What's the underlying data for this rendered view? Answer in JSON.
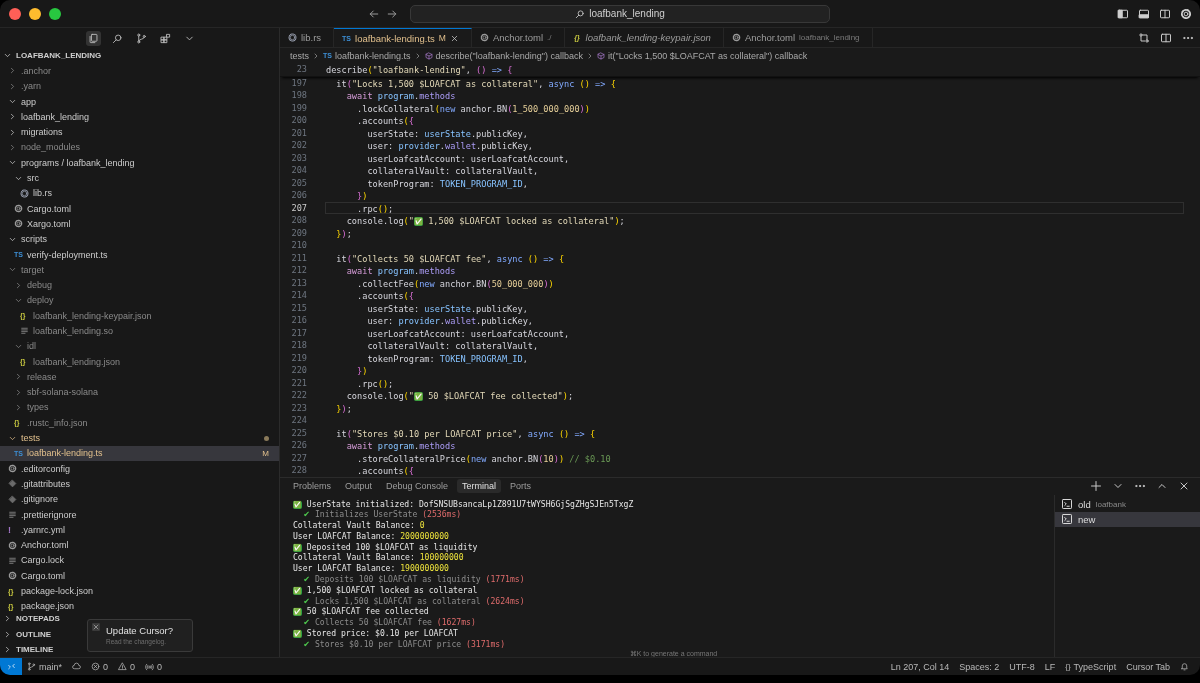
{
  "title_bar": {
    "search": "loafbank_lending"
  },
  "explorer": {
    "title": "LOAFBANK_LENDING",
    "expanded": true,
    "items": [
      {
        "name": ".anchor",
        "kind": "folder",
        "expanded": false,
        "dimmed": true,
        "modified": false,
        "selected": false
      },
      {
        "name": ".yarn",
        "kind": "folder",
        "expanded": false,
        "dimmed": true,
        "modified": false,
        "selected": false
      },
      {
        "name": "app",
        "kind": "folder",
        "expanded": true,
        "dimmed": false,
        "modified": false,
        "selected": false
      },
      {
        "name": "loafbank_lending",
        "kind": "folder",
        "expanded": false,
        "dimmed": false,
        "modified": false,
        "selected": false
      },
      {
        "name": "migrations",
        "kind": "folder",
        "expanded": false,
        "dimmed": false,
        "modified": false,
        "selected": false
      },
      {
        "name": "node_modules",
        "kind": "folder",
        "expanded": false,
        "dimmed": true,
        "modified": false,
        "selected": false
      },
      {
        "name": "programs / loafbank_lending",
        "kind": "folder",
        "expanded": true,
        "dimmed": false,
        "modified": false,
        "selected": false,
        "children": [
          {
            "name": "src",
            "kind": "folder",
            "expanded": true,
            "dimmed": false,
            "modified": false,
            "selected": false,
            "children": [
              {
                "name": "lib.rs",
                "kind": "rust",
                "dimmed": false,
                "modified": false,
                "selected": false
              }
            ]
          },
          {
            "name": "Cargo.toml",
            "kind": "config",
            "dimmed": false,
            "modified": false,
            "selected": false
          },
          {
            "name": "Xargo.toml",
            "kind": "config",
            "dimmed": false,
            "modified": false,
            "selected": false
          }
        ]
      },
      {
        "name": "scripts",
        "kind": "folder",
        "expanded": true,
        "dimmed": false,
        "modified": false,
        "selected": false,
        "children": [
          {
            "name": "verify-deployment.ts",
            "kind": "typescript",
            "glyph": "TS",
            "dimmed": false,
            "modified": false,
            "selected": false
          }
        ]
      },
      {
        "name": "target",
        "kind": "folder",
        "expanded": true,
        "dimmed": true,
        "modified": false,
        "selected": false,
        "children": [
          {
            "name": "debug",
            "kind": "folder",
            "expanded": false,
            "dimmed": true,
            "modified": false,
            "selected": false
          },
          {
            "name": "deploy",
            "kind": "folder",
            "expanded": true,
            "dimmed": true,
            "modified": false,
            "selected": false,
            "children": [
              {
                "name": "loafbank_lending-keypair.json",
                "kind": "json",
                "glyph": "{}",
                "dimmed": true,
                "modified": false,
                "selected": false
              },
              {
                "name": "loafbank_lending.so",
                "kind": "text",
                "dimmed": true,
                "modified": false,
                "selected": false
              }
            ]
          },
          {
            "name": "idl",
            "kind": "folder",
            "expanded": true,
            "dimmed": true,
            "modified": false,
            "selected": false,
            "children": [
              {
                "name": "loafbank_lending.json",
                "kind": "json",
                "glyph": "{}",
                "dimmed": true,
                "modified": false,
                "selected": false
              }
            ]
          },
          {
            "name": "release",
            "kind": "folder",
            "expanded": false,
            "dimmed": true,
            "modified": false,
            "selected": false
          },
          {
            "name": "sbf-solana-solana",
            "kind": "folder",
            "expanded": false,
            "dimmed": true,
            "modified": false,
            "selected": false
          },
          {
            "name": "types",
            "kind": "folder",
            "expanded": false,
            "dimmed": true,
            "modified": false,
            "selected": false
          },
          {
            "name": ".rustc_info.json",
            "kind": "json",
            "glyph": "{}",
            "dimmed": true,
            "modified": false,
            "selected": false
          }
        ]
      },
      {
        "name": "tests",
        "kind": "folder",
        "expanded": true,
        "dimmed": false,
        "modified": true,
        "selected": false,
        "children": [
          {
            "name": "loafbank-lending.ts",
            "kind": "typescript",
            "glyph": "TS",
            "badge": "M",
            "dimmed": false,
            "modified": true,
            "selected": true
          }
        ]
      },
      {
        "name": ".editorconfig",
        "kind": "config",
        "dimmed": false,
        "modified": false,
        "selected": false
      },
      {
        "name": ".gitattributes",
        "kind": "git",
        "dimmed": false,
        "modified": false,
        "selected": false
      },
      {
        "name": ".gitignore",
        "kind": "git",
        "dimmed": false,
        "modified": false,
        "selected": false
      },
      {
        "name": ".prettierignore",
        "kind": "text",
        "dimmed": false,
        "modified": false,
        "selected": false
      },
      {
        "name": ".yarnrc.yml",
        "kind": "yaml",
        "glyph": "!",
        "dimmed": false,
        "modified": false,
        "selected": false
      },
      {
        "name": "Anchor.toml",
        "kind": "config",
        "dimmed": false,
        "modified": false,
        "selected": false
      },
      {
        "name": "Cargo.lock",
        "kind": "text",
        "dimmed": false,
        "modified": false,
        "selected": false
      },
      {
        "name": "Cargo.toml",
        "kind": "config",
        "dimmed": false,
        "modified": false,
        "selected": false
      },
      {
        "name": "package-lock.json",
        "kind": "json",
        "glyph": "{}",
        "dimmed": false,
        "modified": false,
        "selected": false
      },
      {
        "name": "package.json",
        "kind": "json",
        "glyph": "{}",
        "dimmed": false,
        "modified": false,
        "selected": false
      }
    ]
  },
  "sections": [
    {
      "title": "NOTEPADS",
      "expanded": false
    },
    {
      "title": "OUTLINE",
      "expanded": false
    },
    {
      "title": "TIMELINE",
      "expanded": false
    }
  ],
  "notification": {
    "title": "Update Cursor?",
    "message": "Read the changelog."
  },
  "editor_tabs": [
    {
      "label": "lib.rs",
      "kind": "rust",
      "selected": false,
      "preview": false
    },
    {
      "label": "loafbank-lending.ts",
      "kind": "typescript",
      "glyph": "TS",
      "badge": "M",
      "selected": true,
      "preview": false
    },
    {
      "label": "Anchor.toml",
      "description": "./",
      "kind": "config",
      "selected": false,
      "preview": false
    },
    {
      "label": "loafbank_lending-keypair.json",
      "kind": "json",
      "glyph": "{}",
      "selected": false,
      "preview": true
    },
    {
      "label": "Anchor.toml",
      "description": "loafbank_lending",
      "kind": "config",
      "selected": false,
      "preview": false
    }
  ],
  "breadcrumbs": [
    {
      "text": "tests",
      "kind": "folder"
    },
    {
      "text": "loafbank-lending.ts",
      "kind": "typescript",
      "glyph": "TS"
    },
    {
      "text": "describe(\"loafbank-lending\") callback",
      "kind": "symbol"
    },
    {
      "text": "it(\"Locks 1,500 $LOAFCAT as collateral\") callback",
      "kind": "symbol"
    }
  ],
  "sticky_line": {
    "number": "23",
    "tokens": [
      {
        "kind": "p",
        "text": "describe"
      },
      {
        "kind": "y",
        "text": "("
      },
      {
        "kind": "s",
        "text": "\"loafbank-lending\""
      },
      {
        "kind": "p",
        "text": ", "
      },
      {
        "kind": "q",
        "text": "()"
      },
      {
        "kind": "k",
        "text": " => "
      },
      {
        "kind": "q",
        "text": "{"
      }
    ]
  },
  "code_lines": [
    {
      "number": "197",
      "current": false,
      "tokens": [
        {
          "kind": "p",
          "text": "  it"
        },
        {
          "kind": "q",
          "text": "("
        },
        {
          "kind": "s",
          "text": "\"Locks 1,500 $LOAFCAT as collateral\""
        },
        {
          "kind": "p",
          "text": ", "
        },
        {
          "kind": "k",
          "text": "async "
        },
        {
          "kind": "y",
          "text": "()"
        },
        {
          "kind": "k",
          "text": " => "
        },
        {
          "kind": "y",
          "text": "{"
        }
      ]
    },
    {
      "number": "198",
      "current": false,
      "tokens": [
        {
          "kind": "a",
          "text": "    await "
        },
        {
          "kind": "v",
          "text": "program"
        },
        {
          "kind": "p",
          "text": "."
        },
        {
          "kind": "m",
          "text": "methods"
        }
      ]
    },
    {
      "number": "199",
      "current": false,
      "tokens": [
        {
          "kind": "p",
          "text": "      .lockCollateral"
        },
        {
          "kind": "y",
          "text": "("
        },
        {
          "kind": "k",
          "text": "new"
        },
        {
          "kind": "p",
          "text": " anchor.BN"
        },
        {
          "kind": "q",
          "text": "("
        },
        {
          "kind": "n",
          "text": "1_500_000_000"
        },
        {
          "kind": "q",
          "text": ")"
        },
        {
          "kind": "y",
          "text": ")"
        }
      ]
    },
    {
      "number": "200",
      "current": false,
      "tokens": [
        {
          "kind": "p",
          "text": "      .accounts"
        },
        {
          "kind": "y",
          "text": "("
        },
        {
          "kind": "q",
          "text": "{"
        }
      ]
    },
    {
      "number": "201",
      "current": false,
      "tokens": [
        {
          "kind": "p",
          "text": "        userState: "
        },
        {
          "kind": "v",
          "text": "userState"
        },
        {
          "kind": "p",
          "text": ".publicKey,"
        }
      ]
    },
    {
      "number": "202",
      "current": false,
      "tokens": [
        {
          "kind": "p",
          "text": "        user: "
        },
        {
          "kind": "v",
          "text": "provider"
        },
        {
          "kind": "p",
          "text": "."
        },
        {
          "kind": "m",
          "text": "wallet"
        },
        {
          "kind": "p",
          "text": ".publicKey,"
        }
      ]
    },
    {
      "number": "203",
      "current": false,
      "tokens": [
        {
          "kind": "p",
          "text": "        userLoafcatAccount: userLoafcatAccount,"
        }
      ]
    },
    {
      "number": "204",
      "current": false,
      "tokens": [
        {
          "kind": "p",
          "text": "        collateralVault: collateralVault,"
        }
      ]
    },
    {
      "number": "205",
      "current": false,
      "tokens": [
        {
          "kind": "p",
          "text": "        tokenProgram: "
        },
        {
          "kind": "v",
          "text": "TOKEN_PROGRAM_ID"
        },
        {
          "kind": "p",
          "text": ","
        }
      ]
    },
    {
      "number": "206",
      "current": false,
      "tokens": [
        {
          "kind": "q",
          "text": "      }"
        },
        {
          "kind": "y",
          "text": ")"
        }
      ]
    },
    {
      "number": "207",
      "current": true,
      "tokens": [
        {
          "kind": "p",
          "text": "      .rpc"
        },
        {
          "kind": "y",
          "text": "()"
        },
        {
          "kind": "p",
          "text": ";"
        }
      ]
    },
    {
      "number": "208",
      "current": false,
      "tokens": [
        {
          "kind": "p",
          "text": "    console.log"
        },
        {
          "kind": "y",
          "text": "("
        },
        {
          "kind": "s",
          "text": "\""
        },
        {
          "kind": "e",
          "text": "✅"
        },
        {
          "kind": "s",
          "text": " 1,500 $LOAFCAT locked as collateral\""
        },
        {
          "kind": "y",
          "text": ")"
        },
        {
          "kind": "p",
          "text": ";"
        }
      ]
    },
    {
      "number": "209",
      "current": false,
      "tokens": [
        {
          "kind": "y",
          "text": "  }"
        },
        {
          "kind": "q",
          "text": ")"
        },
        {
          "kind": "p",
          "text": ";"
        }
      ]
    },
    {
      "number": "210",
      "current": false
    },
    {
      "number": "211",
      "current": false,
      "tokens": [
        {
          "kind": "p",
          "text": "  it"
        },
        {
          "kind": "q",
          "text": "("
        },
        {
          "kind": "s",
          "text": "\"Collects 50 $LOAFCAT fee\""
        },
        {
          "kind": "p",
          "text": ", "
        },
        {
          "kind": "k",
          "text": "async "
        },
        {
          "kind": "y",
          "text": "()"
        },
        {
          "kind": "k",
          "text": " => "
        },
        {
          "kind": "y",
          "text": "{"
        }
      ]
    },
    {
      "number": "212",
      "current": false,
      "tokens": [
        {
          "kind": "a",
          "text": "    await "
        },
        {
          "kind": "v",
          "text": "program"
        },
        {
          "kind": "p",
          "text": "."
        },
        {
          "kind": "m",
          "text": "methods"
        }
      ]
    },
    {
      "number": "213",
      "current": false,
      "tokens": [
        {
          "kind": "p",
          "text": "      .collectFee"
        },
        {
          "kind": "y",
          "text": "("
        },
        {
          "kind": "k",
          "text": "new"
        },
        {
          "kind": "p",
          "text": " anchor.BN"
        },
        {
          "kind": "q",
          "text": "("
        },
        {
          "kind": "n",
          "text": "50_000_000"
        },
        {
          "kind": "q",
          "text": ")"
        },
        {
          "kind": "y",
          "text": ")"
        }
      ]
    },
    {
      "number": "214",
      "current": false,
      "tokens": [
        {
          "kind": "p",
          "text": "      .accounts"
        },
        {
          "kind": "y",
          "text": "("
        },
        {
          "kind": "q",
          "text": "{"
        }
      ]
    },
    {
      "number": "215",
      "current": false,
      "tokens": [
        {
          "kind": "p",
          "text": "        userState: "
        },
        {
          "kind": "v",
          "text": "userState"
        },
        {
          "kind": "p",
          "text": ".publicKey,"
        }
      ]
    },
    {
      "number": "216",
      "current": false,
      "tokens": [
        {
          "kind": "p",
          "text": "        user: "
        },
        {
          "kind": "v",
          "text": "provider"
        },
        {
          "kind": "p",
          "text": "."
        },
        {
          "kind": "m",
          "text": "wallet"
        },
        {
          "kind": "p",
          "text": ".publicKey,"
        }
      ]
    },
    {
      "number": "217",
      "current": false,
      "tokens": [
        {
          "kind": "p",
          "text": "        userLoafcatAccount: userLoafcatAccount,"
        }
      ]
    },
    {
      "number": "218",
      "current": false,
      "tokens": [
        {
          "kind": "p",
          "text": "        collateralVault: collateralVault,"
        }
      ]
    },
    {
      "number": "219",
      "current": false,
      "tokens": [
        {
          "kind": "p",
          "text": "        tokenProgram: "
        },
        {
          "kind": "v",
          "text": "TOKEN_PROGRAM_ID"
        },
        {
          "kind": "p",
          "text": ","
        }
      ]
    },
    {
      "number": "220",
      "current": false,
      "tokens": [
        {
          "kind": "q",
          "text": "      }"
        },
        {
          "kind": "y",
          "text": ")"
        }
      ]
    },
    {
      "number": "221",
      "current": false,
      "tokens": [
        {
          "kind": "p",
          "text": "      .rpc"
        },
        {
          "kind": "y",
          "text": "()"
        },
        {
          "kind": "p",
          "text": ";"
        }
      ]
    },
    {
      "number": "222",
      "current": false,
      "tokens": [
        {
          "kind": "p",
          "text": "    console.log"
        },
        {
          "kind": "y",
          "text": "("
        },
        {
          "kind": "s",
          "text": "\""
        },
        {
          "kind": "e",
          "text": "✅"
        },
        {
          "kind": "s",
          "text": " 50 $LOAFCAT fee collected\""
        },
        {
          "kind": "y",
          "text": ")"
        },
        {
          "kind": "p",
          "text": ";"
        }
      ]
    },
    {
      "number": "223",
      "current": false,
      "tokens": [
        {
          "kind": "y",
          "text": "  }"
        },
        {
          "kind": "q",
          "text": ")"
        },
        {
          "kind": "p",
          "text": ";"
        }
      ]
    },
    {
      "number": "224",
      "current": false
    },
    {
      "number": "225",
      "current": false,
      "tokens": [
        {
          "kind": "p",
          "text": "  it"
        },
        {
          "kind": "q",
          "text": "("
        },
        {
          "kind": "s",
          "text": "\"Stores $0.10 per LOAFCAT price\""
        },
        {
          "kind": "p",
          "text": ", "
        },
        {
          "kind": "k",
          "text": "async "
        },
        {
          "kind": "y",
          "text": "()"
        },
        {
          "kind": "k",
          "text": " => "
        },
        {
          "kind": "y",
          "text": "{"
        }
      ]
    },
    {
      "number": "226",
      "current": false,
      "tokens": [
        {
          "kind": "a",
          "text": "    await "
        },
        {
          "kind": "v",
          "text": "program"
        },
        {
          "kind": "p",
          "text": "."
        },
        {
          "kind": "m",
          "text": "methods"
        }
      ]
    },
    {
      "number": "227",
      "current": false,
      "tokens": [
        {
          "kind": "p",
          "text": "      .storeCollateralPrice"
        },
        {
          "kind": "y",
          "text": "("
        },
        {
          "kind": "k",
          "text": "new"
        },
        {
          "kind": "p",
          "text": " anchor.BN"
        },
        {
          "kind": "q",
          "text": "("
        },
        {
          "kind": "n",
          "text": "10"
        },
        {
          "kind": "q",
          "text": ")"
        },
        {
          "kind": "y",
          "text": ")"
        },
        {
          "kind": "c",
          "text": " // $0.10"
        }
      ]
    },
    {
      "number": "228",
      "current": false,
      "tokens": [
        {
          "kind": "p",
          "text": "      .accounts"
        },
        {
          "kind": "y",
          "text": "("
        },
        {
          "kind": "q",
          "text": "{"
        }
      ]
    }
  ],
  "panel": {
    "tabs": [
      {
        "label": "Problems",
        "selected": false
      },
      {
        "label": "Output",
        "selected": false
      },
      {
        "label": "Debug Console",
        "selected": false
      },
      {
        "label": "Terminal",
        "selected": true
      },
      {
        "label": "Ports",
        "selected": false
      }
    ],
    "terminal_lines": [
      {
        "segments": [
          {
            "kind": "e",
            "text": "✅"
          },
          {
            "kind": "w",
            "text": " UserState initialized: DofSNSUBsancaLp1Z891U7tWYSH6GjSgZHgSJEn5TxgZ"
          }
        ]
      },
      {
        "segments": [
          {
            "kind": "t",
            "text": "    ✔"
          },
          {
            "kind": "g",
            "text": " Initializes UserState "
          },
          {
            "kind": "r",
            "text": "(2536ms)"
          }
        ]
      },
      {
        "segments": [
          {
            "kind": "w",
            "text": "Collateral Vault Balance: "
          },
          {
            "kind": "y",
            "text": "0"
          }
        ]
      },
      {
        "segments": [
          {
            "kind": "w",
            "text": "User LOAFCAT Balance: "
          },
          {
            "kind": "y",
            "text": "2000000000"
          }
        ]
      },
      {
        "segments": [
          {
            "kind": "e",
            "text": "✅"
          },
          {
            "kind": "w",
            "text": " Deposited 100 $LOAFCAT as liquidity"
          }
        ]
      },
      {
        "segments": [
          {
            "kind": "w",
            "text": "Collateral Vault Balance: "
          },
          {
            "kind": "y",
            "text": "100000000"
          }
        ]
      },
      {
        "segments": [
          {
            "kind": "w",
            "text": "User LOAFCAT Balance: "
          },
          {
            "kind": "y",
            "text": "1900000000"
          }
        ]
      },
      {
        "segments": [
          {
            "kind": "t",
            "text": "    ✔"
          },
          {
            "kind": "g",
            "text": " Deposits 100 $LOAFCAT as liquidity "
          },
          {
            "kind": "r",
            "text": "(1771ms)"
          }
        ]
      },
      {
        "segments": [
          {
            "kind": "e",
            "text": "✅"
          },
          {
            "kind": "w",
            "text": " 1,500 $LOAFCAT locked as collateral"
          }
        ]
      },
      {
        "segments": [
          {
            "kind": "t",
            "text": "    ✔"
          },
          {
            "kind": "g",
            "text": " Locks 1,500 $LOAFCAT as collateral "
          },
          {
            "kind": "r",
            "text": "(2624ms)"
          }
        ]
      },
      {
        "segments": [
          {
            "kind": "e",
            "text": "✅"
          },
          {
            "kind": "w",
            "text": " 50 $LOAFCAT fee collected"
          }
        ]
      },
      {
        "segments": [
          {
            "kind": "t",
            "text": "    ✔"
          },
          {
            "kind": "g",
            "text": " Collects 50 $LOAFCAT fee "
          },
          {
            "kind": "r",
            "text": "(1627ms)"
          }
        ]
      },
      {
        "segments": [
          {
            "kind": "e",
            "text": "✅"
          },
          {
            "kind": "w",
            "text": " Stored price: $0.10 per LOAFCAT"
          }
        ]
      },
      {
        "segments": [
          {
            "kind": "t",
            "text": "    ✔"
          },
          {
            "kind": "g",
            "text": " Stores $0.10 per LOAFCAT price "
          },
          {
            "kind": "r",
            "text": "(3171ms)"
          }
        ]
      }
    ],
    "hint": "⌘K to generate a command",
    "terminals": [
      {
        "name": "old",
        "description": "loafbank",
        "selected": false
      },
      {
        "name": "new",
        "selected": true
      }
    ]
  },
  "status_bar": {
    "left": [
      {
        "kind": "branch",
        "text": "main*"
      },
      {
        "kind": "sync"
      },
      {
        "kind": "errors",
        "text": "0"
      },
      {
        "kind": "warnings",
        "text": "0"
      },
      {
        "kind": "ports",
        "text": "0"
      }
    ],
    "right": [
      {
        "kind": "text",
        "text": "Ln 207, Col 14"
      },
      {
        "kind": "text",
        "text": "Spaces: 2"
      },
      {
        "kind": "text",
        "text": "UTF-8"
      },
      {
        "kind": "text",
        "text": "LF"
      },
      {
        "kind": "language",
        "glyph": "{}",
        "text": "TypeScript"
      },
      {
        "kind": "text",
        "text": "Cursor Tab"
      },
      {
        "kind": "bell"
      }
    ]
  }
}
